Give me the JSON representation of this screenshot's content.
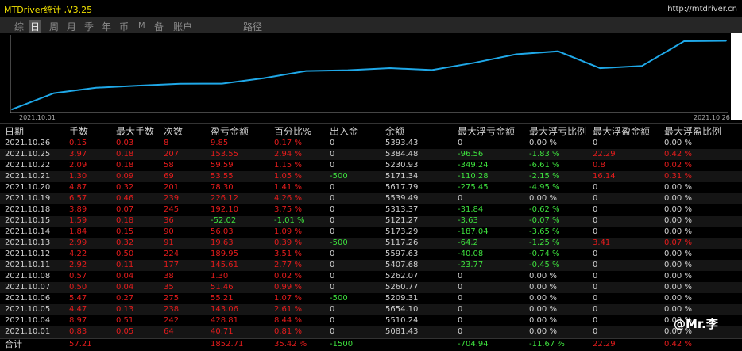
{
  "window": {
    "title": "MTDriver统计 ,V3.25",
    "url": "http://mtdriver.cn"
  },
  "tabs": [
    {
      "label": "综",
      "active": false
    },
    {
      "label": "日",
      "active": true
    },
    {
      "label": "周",
      "active": false
    },
    {
      "label": "月",
      "active": false
    },
    {
      "label": "季",
      "active": false
    },
    {
      "label": "年",
      "active": false
    },
    {
      "label": "币",
      "active": false
    },
    {
      "label": "M",
      "active": false
    },
    {
      "label": "备",
      "active": false
    },
    {
      "label": "账户",
      "active": false
    },
    {
      "label": "路径",
      "active": false
    }
  ],
  "chart_data": {
    "type": "line",
    "x_start_label": "2021.10.01",
    "x_end_label": "2021.10.26",
    "x": [
      "2021.10.01",
      "2021.10.04",
      "2021.10.05",
      "2021.10.06",
      "2021.10.07",
      "2021.10.08",
      "2021.10.11",
      "2021.10.12",
      "2021.10.13",
      "2021.10.14",
      "2021.10.15",
      "2021.10.18",
      "2021.10.19",
      "2021.10.20",
      "2021.10.21",
      "2021.10.22",
      "2021.10.25",
      "2021.10.26"
    ],
    "values": [
      40.71,
      469.52,
      612.58,
      667.79,
      719.25,
      720.55,
      866.16,
      1056.11,
      1075.74,
      1131.77,
      1079.75,
      1271.85,
      1497.97,
      1576.27,
      1129.8,
      1189.39,
      1842.94,
      1852.71
    ],
    "line_color": "#1fa8e8"
  },
  "table": {
    "headers": [
      "日期",
      "手数",
      "最大手数",
      "次数",
      "盈亏金额",
      "百分比%",
      "出入金",
      "余额",
      "最大浮亏金额",
      "最大浮亏比例",
      "最大浮盈金额",
      "最大浮盈比例"
    ],
    "rows": [
      [
        "2021.10.26",
        "0.15",
        "0.03",
        "8",
        "9.85",
        "0.17 %",
        "0",
        "5393.43",
        "0",
        "0.00 %",
        "0",
        "0.00 %"
      ],
      [
        "2021.10.25",
        "3.97",
        "0.18",
        "207",
        "153.55",
        "2.94 %",
        "0",
        "5384.48",
        "-96.56",
        "-1.83 %",
        "22.29",
        "0.42 %"
      ],
      [
        "2021.10.22",
        "2.09",
        "0.18",
        "58",
        "59.59",
        "1.15 %",
        "0",
        "5230.93",
        "-349.24",
        "-6.61 %",
        "0.8",
        "0.02 %"
      ],
      [
        "2021.10.21",
        "1.30",
        "0.09",
        "69",
        "53.55",
        "1.05 %",
        "-500",
        "5171.34",
        "-110.28",
        "-2.15 %",
        "16.14",
        "0.31 %"
      ],
      [
        "2021.10.20",
        "4.87",
        "0.32",
        "201",
        "78.30",
        "1.41 %",
        "0",
        "5617.79",
        "-275.45",
        "-4.95 %",
        "0",
        "0.00 %"
      ],
      [
        "2021.10.19",
        "6.57",
        "0.46",
        "239",
        "226.12",
        "4.26 %",
        "0",
        "5539.49",
        "0",
        "0.00 %",
        "0",
        "0.00 %"
      ],
      [
        "2021.10.18",
        "3.89",
        "0.07",
        "245",
        "192.10",
        "3.75 %",
        "0",
        "5313.37",
        "-31.84",
        "-0.62 %",
        "0",
        "0.00 %"
      ],
      [
        "2021.10.15",
        "1.59",
        "0.18",
        "36",
        "-52.02",
        "-1.01 %",
        "0",
        "5121.27",
        "-3.63",
        "-0.07 %",
        "0",
        "0.00 %"
      ],
      [
        "2021.10.14",
        "1.84",
        "0.15",
        "90",
        "56.03",
        "1.09 %",
        "0",
        "5173.29",
        "-187.04",
        "-3.65 %",
        "0",
        "0.00 %"
      ],
      [
        "2021.10.13",
        "2.99",
        "0.32",
        "91",
        "19.63",
        "0.39 %",
        "-500",
        "5117.26",
        "-64.2",
        "-1.25 %",
        "3.41",
        "0.07 %"
      ],
      [
        "2021.10.12",
        "4.22",
        "0.50",
        "224",
        "189.95",
        "3.51 %",
        "0",
        "5597.63",
        "-40.08",
        "-0.74 %",
        "0",
        "0.00 %"
      ],
      [
        "2021.10.11",
        "2.92",
        "0.11",
        "177",
        "145.61",
        "2.77 %",
        "0",
        "5407.68",
        "-23.77",
        "-0.45 %",
        "0",
        "0.00 %"
      ],
      [
        "2021.10.08",
        "0.57",
        "0.04",
        "38",
        "1.30",
        "0.02 %",
        "0",
        "5262.07",
        "0",
        "0.00 %",
        "0",
        "0.00 %"
      ],
      [
        "2021.10.07",
        "0.50",
        "0.04",
        "35",
        "51.46",
        "0.99 %",
        "0",
        "5260.77",
        "0",
        "0.00 %",
        "0",
        "0.00 %"
      ],
      [
        "2021.10.06",
        "5.47",
        "0.27",
        "275",
        "55.21",
        "1.07 %",
        "-500",
        "5209.31",
        "0",
        "0.00 %",
        "0",
        "0.00 %"
      ],
      [
        "2021.10.05",
        "4.47",
        "0.13",
        "238",
        "143.06",
        "2.61 %",
        "0",
        "5654.10",
        "0",
        "0.00 %",
        "0",
        "0.00 %"
      ],
      [
        "2021.10.04",
        "8.97",
        "0.51",
        "242",
        "428.81",
        "8.44 %",
        "0",
        "5510.24",
        "0",
        "0.00 %",
        "0",
        "0.00 %"
      ],
      [
        "2021.10.01",
        "0.83",
        "0.05",
        "64",
        "40.71",
        "0.81 %",
        "0",
        "5081.43",
        "0",
        "0.00 %",
        "0",
        "0.00 %"
      ]
    ],
    "total": [
      "合计",
      "57.21",
      "",
      "",
      "1852.71",
      "35.42 %",
      "-1500",
      "",
      "-704.94",
      "-11.67 %",
      "22.29",
      "0.42 %"
    ]
  },
  "watermark": "@Mr.李",
  "colors": {
    "positive": "#e41c1c",
    "negative": "#3ee03e",
    "neutral": "#d0d0d0",
    "title": "#f0e000"
  }
}
